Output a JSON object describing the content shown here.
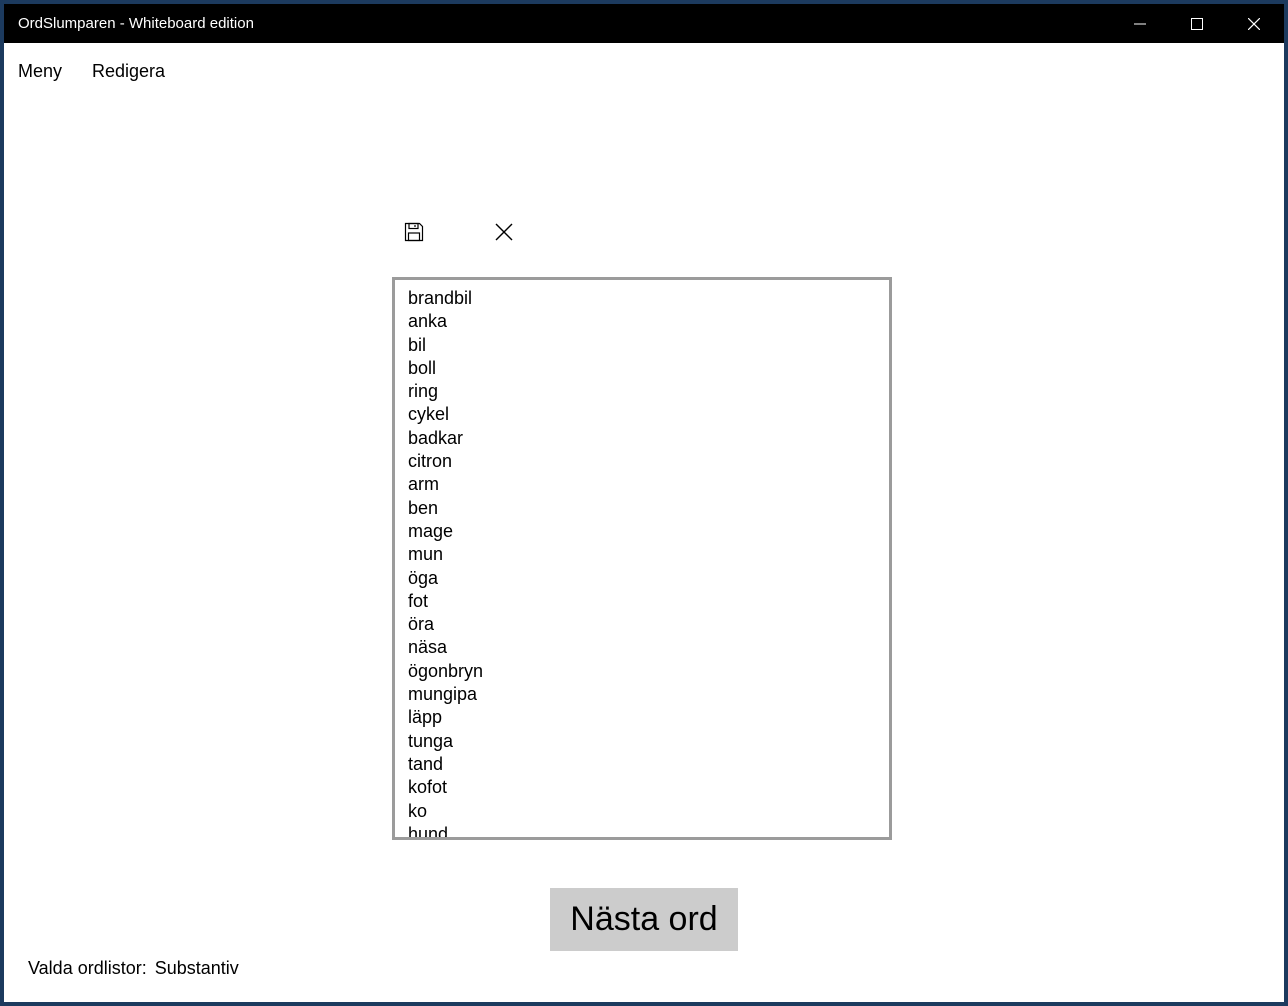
{
  "window": {
    "title": "OrdSlumparen - Whiteboard edition"
  },
  "menu": {
    "items": [
      "Meny",
      "Redigera"
    ]
  },
  "toolbar": {
    "save_icon": "save-icon",
    "close_icon": "close-icon"
  },
  "wordlist": {
    "words": [
      "brandbil",
      "anka",
      "bil",
      "boll",
      "ring",
      "cykel",
      "badkar",
      "citron",
      "arm",
      "ben",
      "mage",
      "mun",
      "öga",
      "fot",
      "öra",
      "näsa",
      "ögonbryn",
      "mungipa",
      "läpp",
      "tunga",
      "tand",
      "kofot",
      "ko",
      "hund"
    ]
  },
  "next_button": {
    "label": "Nästa ord"
  },
  "status": {
    "label": "Valda ordlistor:",
    "value": "Substantiv"
  },
  "colors": {
    "titlebar": "#000000",
    "button_bg": "#cccccc",
    "list_border": "#9b9b9b",
    "desktop": "#1c3a5e"
  }
}
